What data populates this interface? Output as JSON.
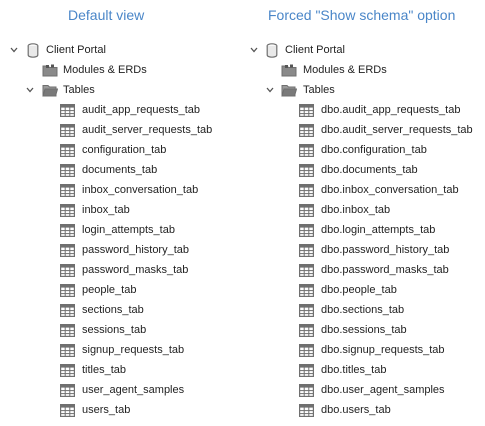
{
  "left": {
    "heading": "Default view",
    "database": "Client Portal",
    "modules": "Modules & ERDs",
    "tables_folder": "Tables",
    "tables": [
      "audit_app_requests_tab",
      "audit_server_requests_tab",
      "configuration_tab",
      "documents_tab",
      "inbox_conversation_tab",
      "inbox_tab",
      "login_attempts_tab",
      "password_history_tab",
      "password_masks_tab",
      "people_tab",
      "sections_tab",
      "sessions_tab",
      "signup_requests_tab",
      "titles_tab",
      "user_agent_samples",
      "users_tab"
    ]
  },
  "right": {
    "heading": "Forced \"Show schema\" option",
    "database": "Client Portal",
    "modules": "Modules & ERDs",
    "tables_folder": "Tables",
    "tables": [
      "dbo.audit_app_requests_tab",
      "dbo.audit_server_requests_tab",
      "dbo.configuration_tab",
      "dbo.documents_tab",
      "dbo.inbox_conversation_tab",
      "dbo.inbox_tab",
      "dbo.login_attempts_tab",
      "dbo.password_history_tab",
      "dbo.password_masks_tab",
      "dbo.people_tab",
      "dbo.sections_tab",
      "dbo.sessions_tab",
      "dbo.signup_requests_tab",
      "dbo.titles_tab",
      "dbo.user_agent_samples",
      "dbo.users_tab"
    ]
  },
  "icons": {
    "expand": "chevron-down-icon",
    "database": "database-icon",
    "folder": "folder-icon",
    "folder_open": "folder-open-icon",
    "table": "table-icon"
  },
  "colors": {
    "heading": "#4a86c8",
    "icon": "#6f6f6f",
    "text": "#1f1f1f"
  }
}
